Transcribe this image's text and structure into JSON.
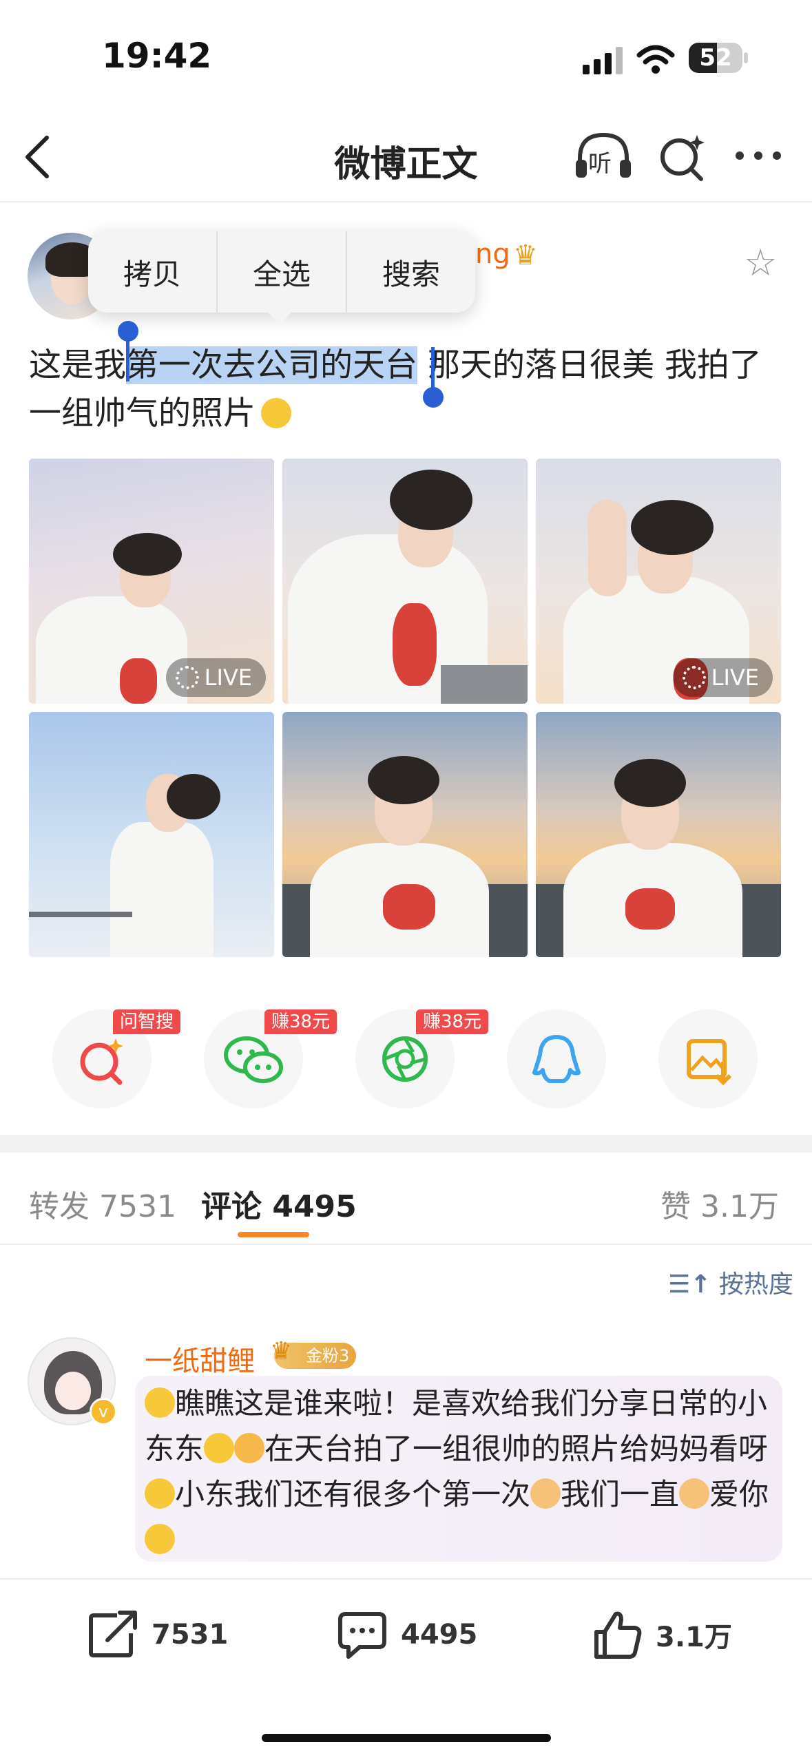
{
  "status_bar": {
    "time": "19:42",
    "battery": "52"
  },
  "nav": {
    "title": "微博正文",
    "listen_label": "听"
  },
  "post": {
    "username_visible": "ng",
    "context_menu": [
      "拷贝",
      "全选",
      "搜索"
    ],
    "text_before": "这是我",
    "text_selected": "第一次去公司的天台",
    "text_after": " 那天的落日很美 我拍了一组帅气的照片",
    "photos": [
      {
        "live": true
      },
      {
        "live": false
      },
      {
        "live": true
      },
      {
        "live": false
      },
      {
        "live": false
      },
      {
        "live": false
      }
    ],
    "live_label": "LIVE"
  },
  "share": [
    {
      "icon": "ai-search-icon",
      "tag": "问智搜",
      "color": "#f0484b"
    },
    {
      "icon": "wechat-icon",
      "tag": "赚38元",
      "color": "#2fb84e"
    },
    {
      "icon": "moments-icon",
      "tag": "赚38元",
      "color": "#2fb84e"
    },
    {
      "icon": "qq-icon",
      "tag": "",
      "color": "#3da4f0"
    },
    {
      "icon": "save-image-icon",
      "tag": "",
      "color": "#f0a21f"
    }
  ],
  "tabs": {
    "repost_label": "转发",
    "repost_count": "7531",
    "comment_label": "评论",
    "comment_count": "4495",
    "like_label": "赞",
    "like_count": "3.1万",
    "sort_label": "按热度"
  },
  "comment": {
    "name": "一纸甜鲤",
    "fan_badge": "金粉3",
    "text_1": "瞧瞧这是谁来啦！是喜欢给我们分享日常的小东东",
    "text_2": "在天台拍了一组很帅的照片给妈妈看呀",
    "text_3": "小东我们还有很多个第一次",
    "text_4": "我们一直",
    "text_5": "爱你"
  },
  "bottom_bar": {
    "repost": "7531",
    "comment": "4495",
    "like": "3.1万"
  }
}
